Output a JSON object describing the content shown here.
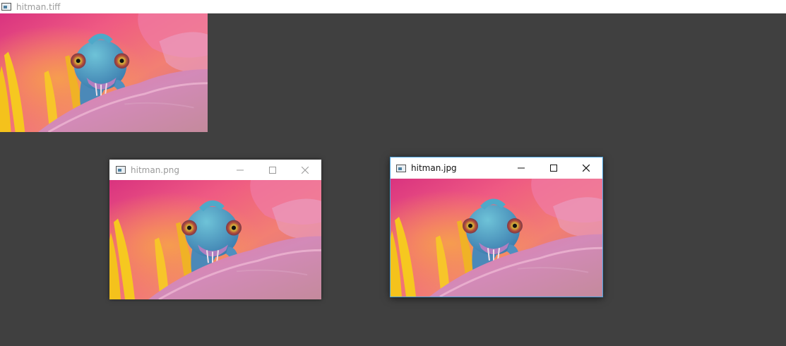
{
  "windows": [
    {
      "title": "hitman.tiff",
      "state": "inactive"
    },
    {
      "title": "hitman.png",
      "state": "inactive",
      "controls": [
        "minimize-icon",
        "maximize-icon",
        "close-icon"
      ]
    },
    {
      "title": "hitman.jpg",
      "state": "active",
      "controls": [
        "minimize-icon",
        "maximize-icon",
        "close-icon"
      ]
    }
  ],
  "colors": {
    "desktop": "#404040",
    "active_border": "#4aa3df",
    "titlebar": "#ffffff"
  }
}
